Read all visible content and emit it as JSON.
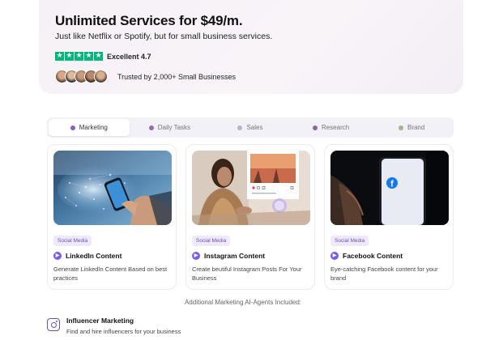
{
  "hero": {
    "title": "Unlimited Services for $49/m.",
    "subtitle": "Just like Netflix or Spotify, but for small business services.",
    "rating_label": "Excellent 4.7",
    "stars": 5,
    "trusted_label": "Trusted by 2,000+ Small Businesses",
    "star_color": "#00b67a"
  },
  "tabs": [
    {
      "label": "Marketing",
      "active": true,
      "dot_color": "#8a5cc8"
    },
    {
      "label": "Daily Tasks",
      "active": false,
      "dot_color": "#a06aa8"
    },
    {
      "label": "Sales",
      "active": false,
      "dot_color": "#b8b4d0"
    },
    {
      "label": "Research",
      "active": false,
      "dot_color": "#8a6a9a"
    },
    {
      "label": "Brand",
      "active": false,
      "dot_color": "#9ab88a"
    }
  ],
  "cards": [
    {
      "badge": "Social Media",
      "title": "LinkedIn Content",
      "description": "Generate LinkedIn Content Based on best practices",
      "image": "phone-network-image"
    },
    {
      "badge": "Social Media",
      "title": "Instagram Content",
      "description": "Create beutiful Instagram Posts For Your Business",
      "image": "instagram-woman-image"
    },
    {
      "badge": "Social Media",
      "title": "Facebook Content",
      "description": "Eye-catching Facebook content for your brand",
      "image": "facebook-phone-image"
    }
  ],
  "additional": {
    "heading": "Additional Marketing AI-Agents Included:",
    "items": [
      {
        "title": "Influencer Marketing",
        "description": "Find and hire influencers for your business",
        "icon": "instagram-icon"
      }
    ]
  },
  "accent_color": "#7b5ce6"
}
